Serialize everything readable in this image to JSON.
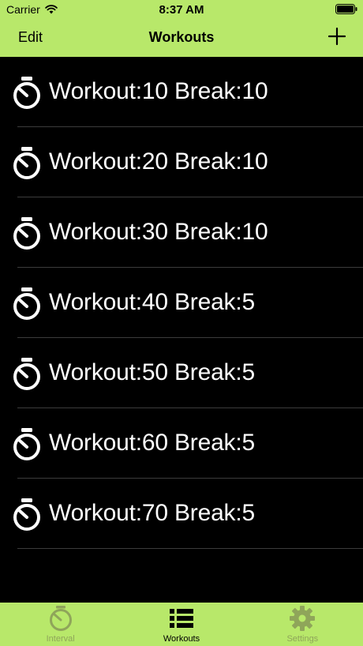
{
  "status_bar": {
    "carrier": "Carrier",
    "time": "8:37 AM"
  },
  "nav_bar": {
    "edit_label": "Edit",
    "title": "Workouts",
    "add_icon": "plus-icon"
  },
  "workouts": [
    {
      "label": "Workout:10 Break:10",
      "icon": "stopwatch-icon"
    },
    {
      "label": "Workout:20 Break:10",
      "icon": "stopwatch-icon"
    },
    {
      "label": "Workout:30 Break:10",
      "icon": "stopwatch-icon"
    },
    {
      "label": "Workout:40 Break:5",
      "icon": "stopwatch-icon"
    },
    {
      "label": "Workout:50 Break:5",
      "icon": "stopwatch-icon"
    },
    {
      "label": "Workout:60 Break:5",
      "icon": "stopwatch-icon"
    },
    {
      "label": "Workout:70 Break:5",
      "icon": "stopwatch-icon"
    }
  ],
  "tab_bar": {
    "tabs": [
      {
        "label": "Interval",
        "icon": "stopwatch-icon",
        "active": false
      },
      {
        "label": "Workouts",
        "icon": "list-icon",
        "active": true
      },
      {
        "label": "Settings",
        "icon": "gear-icon",
        "active": false
      }
    ]
  },
  "colors": {
    "accent": "#b8e86a",
    "background": "#000000",
    "text": "#ffffff",
    "separator": "#3c3c3c",
    "inactive_tab": "#8fa55a"
  }
}
